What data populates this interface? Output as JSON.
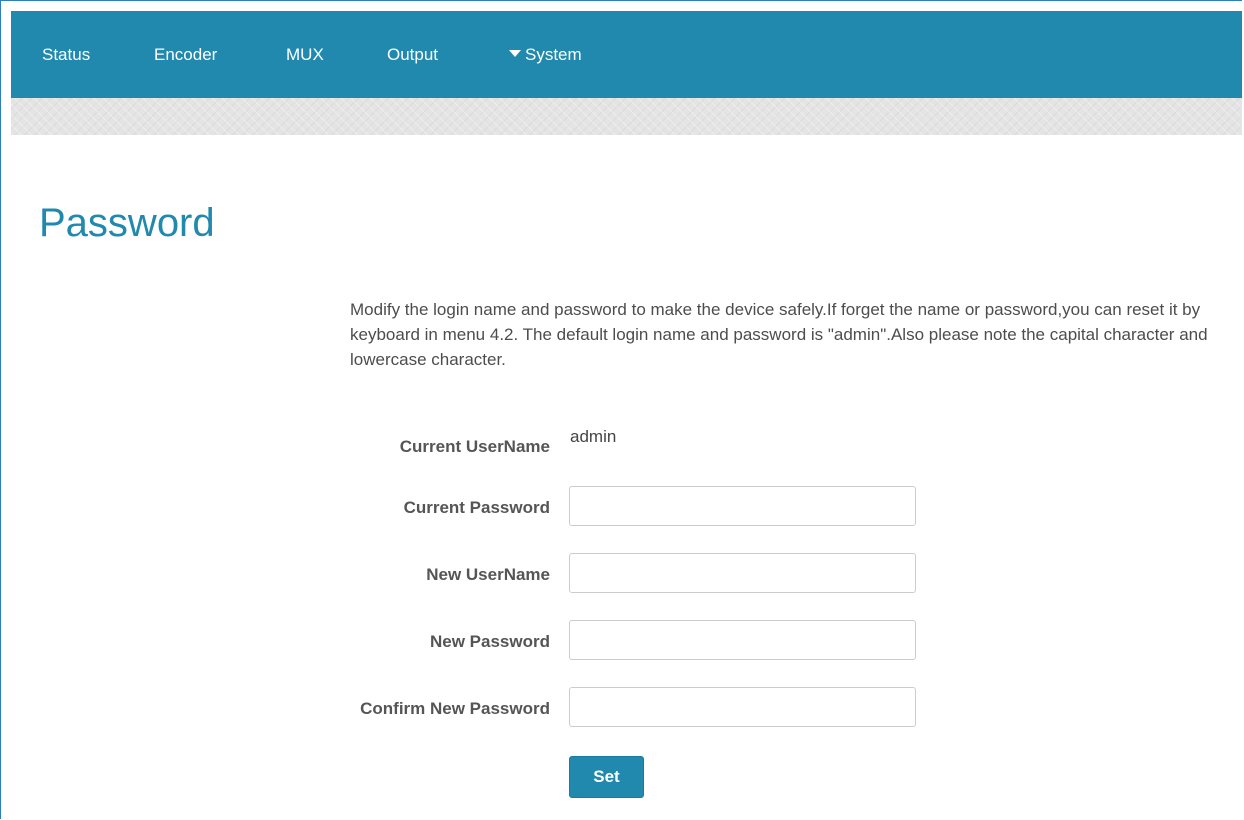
{
  "nav": {
    "items": [
      "Status",
      "Encoder",
      "MUX",
      "Output"
    ],
    "dropdown_label": "System"
  },
  "page": {
    "title": "Password",
    "description": "Modify the login name and password to make the device safely.If forget the name or password,you can reset it by keyboard in menu 4.2. The default login name and password is \"admin\".Also please note the capital character and lowercase character."
  },
  "form": {
    "current_username_label": "Current UserName",
    "current_username_value": "admin",
    "current_password_label": "Current Password",
    "current_password_value": "",
    "new_username_label": "New UserName",
    "new_username_value": "",
    "new_password_label": "New Password",
    "new_password_value": "",
    "confirm_password_label": "Confirm New Password",
    "confirm_password_value": "",
    "submit_label": "Set"
  },
  "colors": {
    "accent": "#2089ad",
    "texture_band": "#e4e4e4"
  },
  "icons": {
    "system_dropdown": "caret-down-icon"
  }
}
